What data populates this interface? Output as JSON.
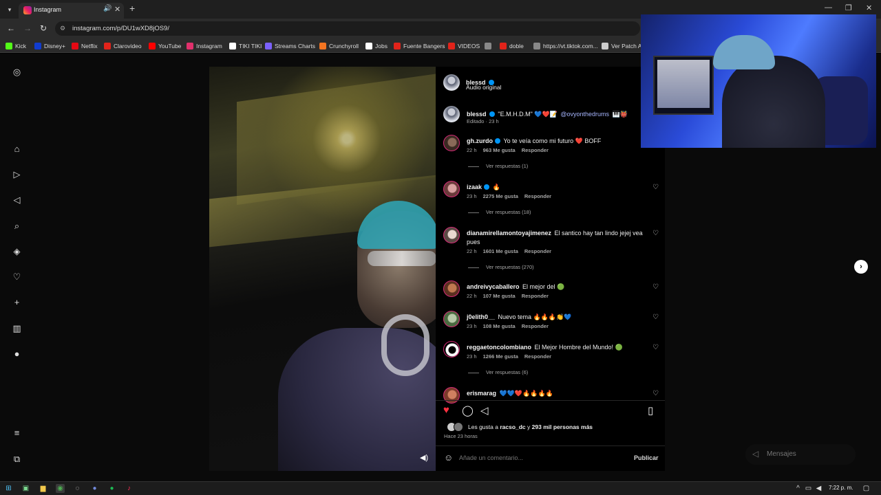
{
  "browser": {
    "tab_title": "Instagram",
    "url": "instagram.com/p/DU1wXD8jOS9/",
    "bookmarks": [
      {
        "label": "Kick",
        "color": "#53fc18"
      },
      {
        "label": "Disney+",
        "color": "#113ccf"
      },
      {
        "label": "Netflix",
        "color": "#e50914"
      },
      {
        "label": "Clarovideo",
        "color": "#e2231a"
      },
      {
        "label": "YouTube",
        "color": "#ff0000"
      },
      {
        "label": "Instagram",
        "color": "#e1306c"
      },
      {
        "label": "TIKI TIKI",
        "color": "#ffffff"
      },
      {
        "label": "Streams Charts",
        "color": "#7b61ff"
      },
      {
        "label": "Crunchyroll",
        "color": "#f47521"
      },
      {
        "label": "Jobs",
        "color": "#ffffff"
      },
      {
        "label": "Fuente Bangers",
        "color": "#e2231a"
      },
      {
        "label": "VIDEOS",
        "color": "#e2231a"
      },
      {
        "label": "",
        "color": "#888888"
      },
      {
        "label": "doble",
        "color": "#e2231a"
      },
      {
        "label": "https://vt.tiktok.com...",
        "color": "#888888"
      },
      {
        "label": "Ver Patch Ac",
        "color": "#cccccc"
      }
    ]
  },
  "post": {
    "header": {
      "username": "blessd",
      "audio": "Audio original"
    },
    "caption": {
      "username": "blessd",
      "text": "\"E.M.H.D.M\" 💙❤️📝",
      "mention": "@ovyonthedrums",
      "emoji_tail": "🎹👹",
      "meta": "Editado · 23 h"
    },
    "comments": [
      {
        "username": "gh.zurdo",
        "text": "Yo te veía como mi futuro ❤️ BOFF",
        "time": "22 h",
        "likes": "963 Me gusta",
        "reply": "Responder",
        "replies": "Ver respuestas (1)"
      },
      {
        "username": "izaak",
        "text": "🔥",
        "time": "23 h",
        "likes": "2275 Me gusta",
        "reply": "Responder",
        "replies": "Ver respuestas (18)"
      },
      {
        "username": "dianamirellamontoyajimenez",
        "text": "El santico hay tan lindo jejej vea pues",
        "time": "22 h",
        "likes": "1601 Me gusta",
        "reply": "Responder",
        "replies": "Ver respuestas (270)"
      },
      {
        "username": "andreivycaballero",
        "text": "El mejor del 🟢",
        "time": "22 h",
        "likes": "107 Me gusta",
        "reply": "Responder",
        "replies": ""
      },
      {
        "username": "j0elith0__",
        "text": "Nuevo tema 🔥🔥🔥👏💙",
        "time": "23 h",
        "likes": "108 Me gusta",
        "reply": "Responder",
        "replies": ""
      },
      {
        "username": "reggaetoncolombiano",
        "text": "El Mejor Hombre del Mundo! 🟢",
        "time": "23 h",
        "likes": "1266 Me gusta",
        "reply": "Responder",
        "replies": "Ver respuestas (6)"
      },
      {
        "username": "erismarag",
        "text": "💙💙❤️🔥🔥🔥🔥",
        "time": "",
        "likes": "",
        "reply": "",
        "replies": ""
      }
    ],
    "likes_prefix": "Les gusta a",
    "likes_user": "racso_dc",
    "likes_middle": "y",
    "likes_count": "293 mil personas más",
    "posted_ago": "Hace 23 horas",
    "comment_placeholder": "Añade un comentario...",
    "publish_label": "Publicar"
  },
  "messages_label": "Mensajes",
  "clock": "7:22 p. m.",
  "colors": {
    "like_red": "#ff3040",
    "link_blue": "#a5b4fc",
    "verified": "#0095f6"
  }
}
